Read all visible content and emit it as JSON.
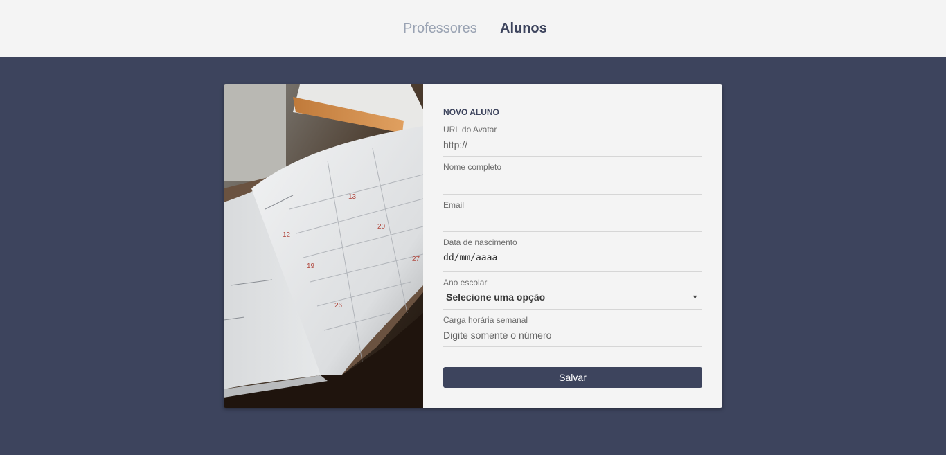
{
  "nav": {
    "items": [
      {
        "label": "Professores",
        "active": false
      },
      {
        "label": "Alunos",
        "active": true
      }
    ]
  },
  "form": {
    "title": "NOVO ALUNO",
    "avatar": {
      "label": "URL do Avatar",
      "placeholder": "http://"
    },
    "name": {
      "label": "Nome completo",
      "placeholder": ""
    },
    "email": {
      "label": "Email",
      "placeholder": ""
    },
    "birthdate": {
      "label": "Data de nascimento",
      "value": "dd/mm/aaaa"
    },
    "grade": {
      "label": "Ano escolar",
      "selected": "Selecione uma opção"
    },
    "hours": {
      "label": "Carga horária semanal",
      "placeholder": "Digite somente o número"
    },
    "submit_label": "Salvar"
  },
  "colors": {
    "primary": "#3d445d",
    "topbar_bg": "#f4f4f4",
    "nav_inactive": "#9aa3b3"
  },
  "image": {
    "alt": "planner-photo"
  }
}
